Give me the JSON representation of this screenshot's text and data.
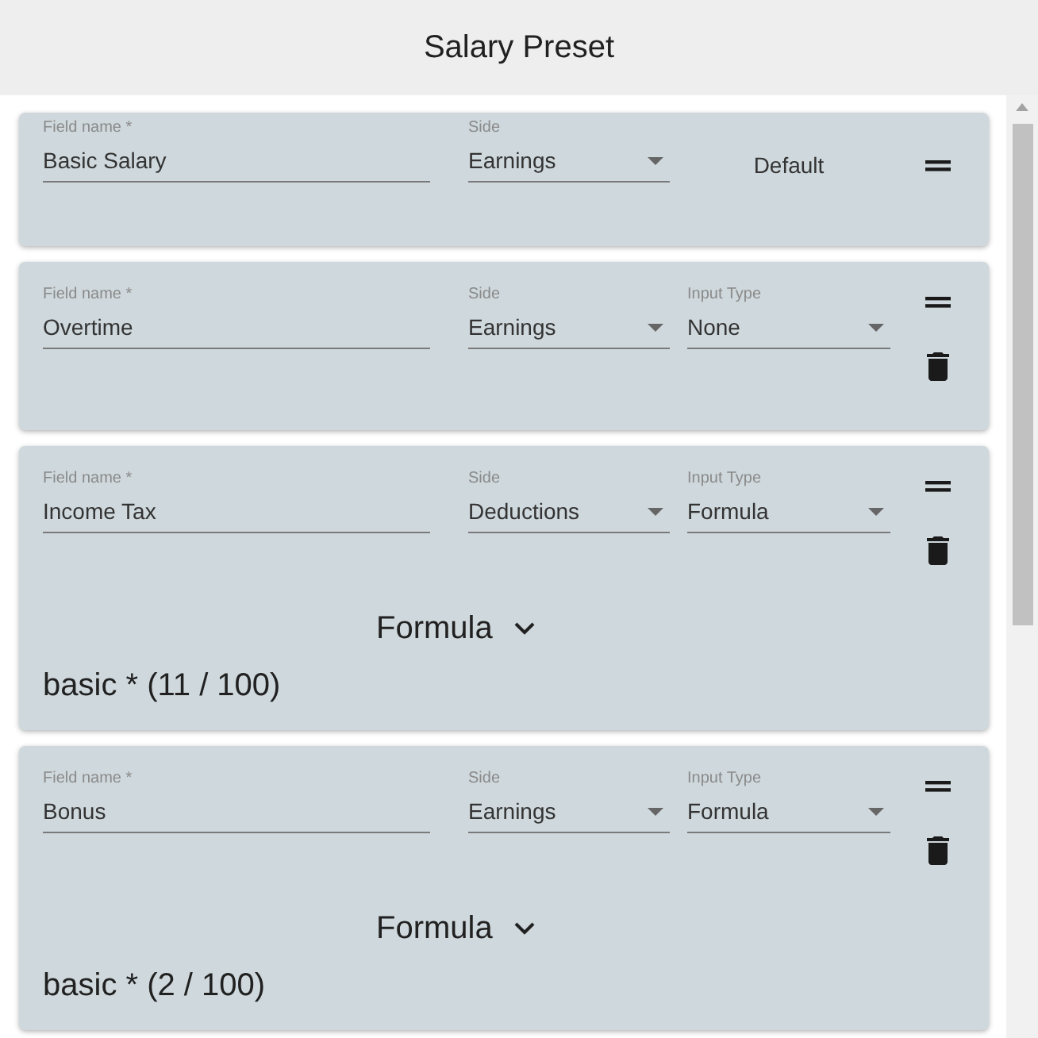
{
  "header": {
    "title": "Salary Preset"
  },
  "fields": [
    {
      "kind": "default",
      "name_label": "Field name *",
      "name": "Basic Salary",
      "side_label": "Side",
      "side": "Earnings",
      "default_label": "Default"
    },
    {
      "kind": "custom",
      "name_label": "Field name *",
      "name": "Overtime",
      "side_label": "Side",
      "side": "Earnings",
      "input_type_label": "Input Type",
      "input_type": "None"
    },
    {
      "kind": "custom",
      "name_label": "Field name *",
      "name": "Income Tax",
      "side_label": "Side",
      "side": "Deductions",
      "input_type_label": "Input Type",
      "input_type": "Formula",
      "formula": {
        "heading": "Formula",
        "expression": "basic * (11 / 100)"
      }
    },
    {
      "kind": "custom",
      "name_label": "Field name *",
      "name": "Bonus",
      "side_label": "Side",
      "side": "Earnings",
      "input_type_label": "Input Type",
      "input_type": "Formula",
      "formula": {
        "heading": "Formula",
        "expression": "basic * (2 / 100)"
      }
    }
  ]
}
